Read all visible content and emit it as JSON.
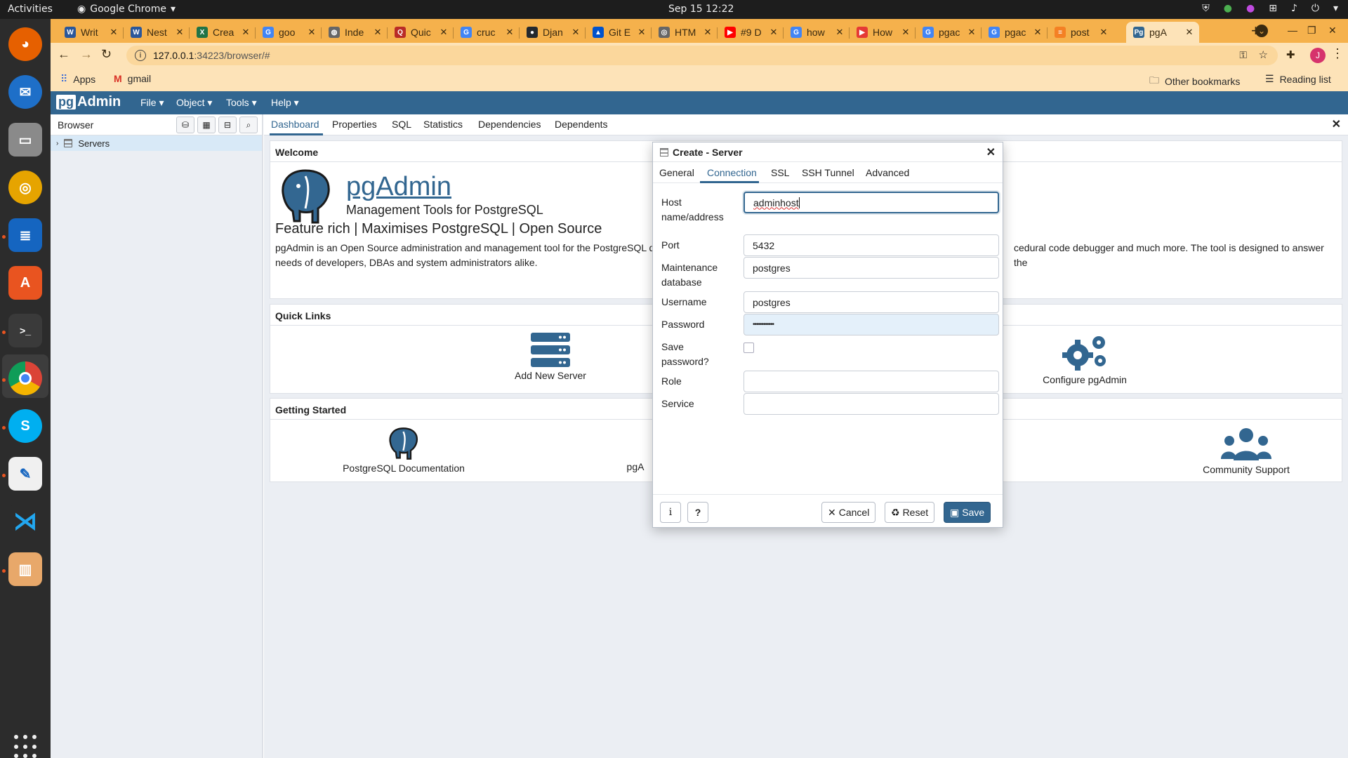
{
  "system": {
    "activities": "Activities",
    "app_name": "Google Chrome",
    "clock": "Sep 15  12:22"
  },
  "browser": {
    "tabs": [
      {
        "title": "Writ",
        "icon": "word-icon",
        "color": "#2b579a",
        "glyph": "W"
      },
      {
        "title": "Nest",
        "icon": "word-icon",
        "color": "#2b579a",
        "glyph": "W"
      },
      {
        "title": "Crea",
        "icon": "excel-icon",
        "color": "#217346",
        "glyph": "X"
      },
      {
        "title": "goo",
        "icon": "google-icon",
        "color": "#4285f4",
        "glyph": "G"
      },
      {
        "title": "Inde",
        "icon": "globe-icon",
        "color": "#666666",
        "glyph": "◍"
      },
      {
        "title": "Quic",
        "icon": "quora-icon",
        "color": "#b92b27",
        "glyph": "Q"
      },
      {
        "title": "cruc",
        "icon": "google-icon",
        "color": "#4285f4",
        "glyph": "G"
      },
      {
        "title": "Djan",
        "icon": "github-icon",
        "color": "#24292e",
        "glyph": "●"
      },
      {
        "title": "Git E",
        "icon": "atlassian-icon",
        "color": "#0052cc",
        "glyph": "▲"
      },
      {
        "title": "HTM",
        "icon": "globe-icon",
        "color": "#666666",
        "glyph": "◎"
      },
      {
        "title": "#9 D",
        "icon": "youtube-icon",
        "color": "#ff0000",
        "glyph": "▶"
      },
      {
        "title": "how",
        "icon": "google-icon",
        "color": "#4285f4",
        "glyph": "G"
      },
      {
        "title": "How",
        "icon": "youtube-icon",
        "color": "#e53935",
        "glyph": "▶"
      },
      {
        "title": "pgac",
        "icon": "google-icon",
        "color": "#4285f4",
        "glyph": "G"
      },
      {
        "title": "pgac",
        "icon": "google-icon",
        "color": "#4285f4",
        "glyph": "G"
      },
      {
        "title": "post",
        "icon": "stackoverflow-icon",
        "color": "#f48024",
        "glyph": "≡"
      },
      {
        "title": "pgA",
        "icon": "pgadmin-icon",
        "color": "#326690",
        "glyph": "Pg"
      }
    ],
    "url_host": "127.0.0.1",
    "url_path": ":34223/browser/#",
    "avatar_letter": "J",
    "bookmarks": {
      "apps": "Apps",
      "gmail": "gmail",
      "other": "Other bookmarks",
      "reading": "Reading list"
    }
  },
  "pgadmin": {
    "logo_pg": "pg",
    "logo_admin": "Admin",
    "menu": [
      "File",
      "Object",
      "Tools",
      "Help"
    ],
    "browser_title": "Browser",
    "tree_root": "Servers",
    "tabs": [
      "Dashboard",
      "Properties",
      "SQL",
      "Statistics",
      "Dependencies",
      "Dependents"
    ],
    "welcome": {
      "header": "Welcome",
      "title": "pgAdmin",
      "subtitle": "Management Tools for PostgreSQL",
      "feature": "Feature rich | Maximises PostgreSQL | Open Source",
      "desc_left": "pgAdmin is an Open Source administration and management tool for the PostgreSQL d",
      "desc_right": "cedural code debugger and much more. The tool is designed to answer the",
      "desc_line2": "needs of developers, DBAs and system administrators alike."
    },
    "quick_links": {
      "header": "Quick Links",
      "add_server": "Add New Server",
      "configure": "Configure pgAdmin"
    },
    "getting_started": {
      "header": "Getting Started",
      "docs": "PostgreSQL Documentation",
      "pga": "pgA",
      "community": "Community Support"
    }
  },
  "dialog": {
    "title": "Create - Server",
    "tabs": [
      "General",
      "Connection",
      "SSL",
      "SSH Tunnel",
      "Advanced"
    ],
    "fields": {
      "host_label_1": "Host",
      "host_label_2": "name/address",
      "host_value": "adminhost",
      "port_label": "Port",
      "port_value": "5432",
      "maint_label_1": "Maintenance",
      "maint_label_2": "database",
      "maint_value": "postgres",
      "user_label": "Username",
      "user_value": "postgres",
      "pass_label": "Password",
      "pass_value": "••••••••••••",
      "save_label_1": "Save",
      "save_label_2": "password?",
      "role_label": "Role",
      "role_value": "",
      "service_label": "Service",
      "service_value": ""
    },
    "buttons": {
      "info": "i",
      "help": "?",
      "cancel": "Cancel",
      "reset": "Reset",
      "save": "Save"
    }
  }
}
